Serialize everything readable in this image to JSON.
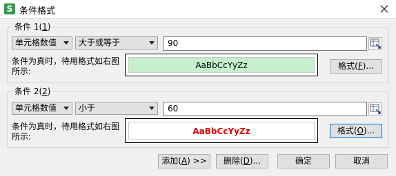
{
  "window": {
    "title": "条件格式",
    "app_icon_letter": "S"
  },
  "condition1": {
    "legend_prefix": "条件 1(",
    "legend_key": "1",
    "legend_suffix": ")",
    "type_select": "单元格数值",
    "operator_select": "大于或等于",
    "value": "90",
    "preview_desc": "条件为真时，待用格式如右图所示:",
    "preview_text": "AaBbCcYyZz",
    "preview_bg": "#c6efce",
    "preview_color": "#000000",
    "format_button_prefix": "格式(",
    "format_button_key": "F",
    "format_button_suffix": ")..."
  },
  "condition2": {
    "legend_prefix": "条件 2(",
    "legend_key": "2",
    "legend_suffix": ")",
    "type_select": "单元格数值",
    "operator_select": "小于",
    "value": "60",
    "preview_desc": "条件为真时，待用格式如右图所示:",
    "preview_text": "AaBbCcYyZz",
    "preview_bg": "#ffffff",
    "preview_color": "#e00000",
    "format_button_prefix": "格式(",
    "format_button_key": "O",
    "format_button_suffix": ")..."
  },
  "buttons": {
    "add_prefix": "添加(",
    "add_key": "A",
    "add_suffix": ") >>",
    "delete_prefix": "删除(",
    "delete_key": "D",
    "delete_suffix": ")...",
    "ok": "确定",
    "cancel": "取消"
  },
  "icons": {
    "close": "close-icon",
    "range_picker": "range-select-icon"
  }
}
